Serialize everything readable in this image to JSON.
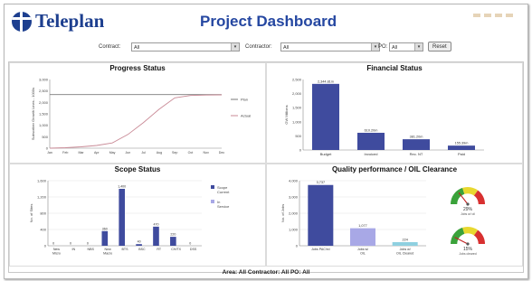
{
  "header": {
    "logo_text": "Teleplan",
    "title": "Project Dashboard"
  },
  "filters": {
    "contract_label": "Contract:",
    "contract_value": "All",
    "contractor_label": "Contractor:",
    "contractor_value": "All",
    "po_label": "PO:",
    "po_value": "All",
    "reset_label": "Reset"
  },
  "panels": {
    "progress": "Progress Status",
    "financial": "Financial Status",
    "scope": "Scope Status",
    "quality": "Quality performance / OIL Clearance"
  },
  "footer": {
    "summary": "Area: All  Contractor: All  PO: All"
  },
  "chart_data": [
    {
      "type": "line",
      "title": "Progress Status",
      "ylabel": "Subscriber Growth Lines - 1000s",
      "x": [
        "Jan",
        "Feb",
        "Mar",
        "Apr",
        "May",
        "Jun",
        "Jul",
        "Aug",
        "Sep",
        "Oct",
        "Nov",
        "Dec"
      ],
      "ylim": [
        0,
        3000
      ],
      "yticks": [
        "0",
        "500",
        "1,000",
        "1,500",
        "2,000",
        "2,500",
        "3,000"
      ],
      "series": [
        {
          "name": "Plan",
          "color": "#7a7a7a",
          "values": [
            2340,
            2340,
            2340,
            2340,
            2340,
            2340,
            2340,
            2340,
            2340,
            2340,
            2340,
            2340
          ]
        },
        {
          "name": "Actual",
          "color": "#c98a96",
          "values": [
            0,
            20,
            60,
            120,
            230,
            600,
            1120,
            1700,
            2200,
            2300,
            2320,
            2330
          ]
        }
      ],
      "grid": true,
      "legend": "right"
    },
    {
      "type": "bar",
      "title": "Financial Status",
      "ylabel": "GW Millions",
      "categories": [
        "Budget",
        "Invoiced",
        "Rec. NT",
        "Paid"
      ],
      "values": [
        2344.81,
        610.2,
        381.2,
        155.39
      ],
      "labels": [
        "2,344.81m",
        "610.20m",
        "381.20m",
        "155.39m"
      ],
      "yticks": [
        "0",
        "500",
        "1,000",
        "1,500",
        "2,000",
        "2,500"
      ],
      "ylim": [
        0,
        2500
      ],
      "color": "#3f4b9e"
    },
    {
      "type": "bar",
      "title": "Scope Status",
      "ylabel": "No. of Sites",
      "categories": [
        "New Micro",
        "IN",
        "NBS",
        "New Macro",
        "BTS",
        "BSC",
        "RT",
        "CH/TX",
        "DSS"
      ],
      "series": [
        {
          "name": "Scope Current",
          "color": "#3f4b9e",
          "values": [
            0,
            0,
            0,
            360,
            1400,
            40,
            470,
            220,
            0
          ]
        },
        {
          "name": "In Service",
          "color": "#a8a8e6",
          "values": [
            0,
            0,
            0,
            0,
            0,
            0,
            0,
            0,
            0
          ]
        }
      ],
      "labels": [
        "0",
        "0",
        "0",
        "360",
        "1,400",
        "40",
        "470",
        "220",
        "0"
      ],
      "yticks": [
        "0",
        "400",
        "800",
        "1,200",
        "1,600"
      ],
      "ylim": [
        0,
        1600
      ],
      "grid": true,
      "legend": "right"
    },
    {
      "type": "bar",
      "title": "Quality performance / OIL Clearance",
      "ylabel": "No. of Jobs",
      "categories": [
        "Jobs PAC'ed",
        "Jobs w/ OIL",
        "Jobs w/ OIL Cleared"
      ],
      "values": [
        3737,
        1,
        1
      ],
      "labels": [
        "3,737",
        "1,077",
        "224"
      ],
      "display_values": [
        3737,
        1077,
        224
      ],
      "colors": [
        "#3f4b9e",
        "#a8a8e6",
        "#8fd0e0"
      ],
      "yticks": [
        "0",
        "1,000",
        "2,000",
        "3,000",
        "4,000"
      ],
      "ylim": [
        0,
        4000
      ]
    }
  ],
  "gauges": [
    {
      "percent": 29,
      "label": "29%",
      "caption": "Jobs w/ oil"
    },
    {
      "percent": 15,
      "label": "15%",
      "caption": "Jobs cleared"
    }
  ]
}
